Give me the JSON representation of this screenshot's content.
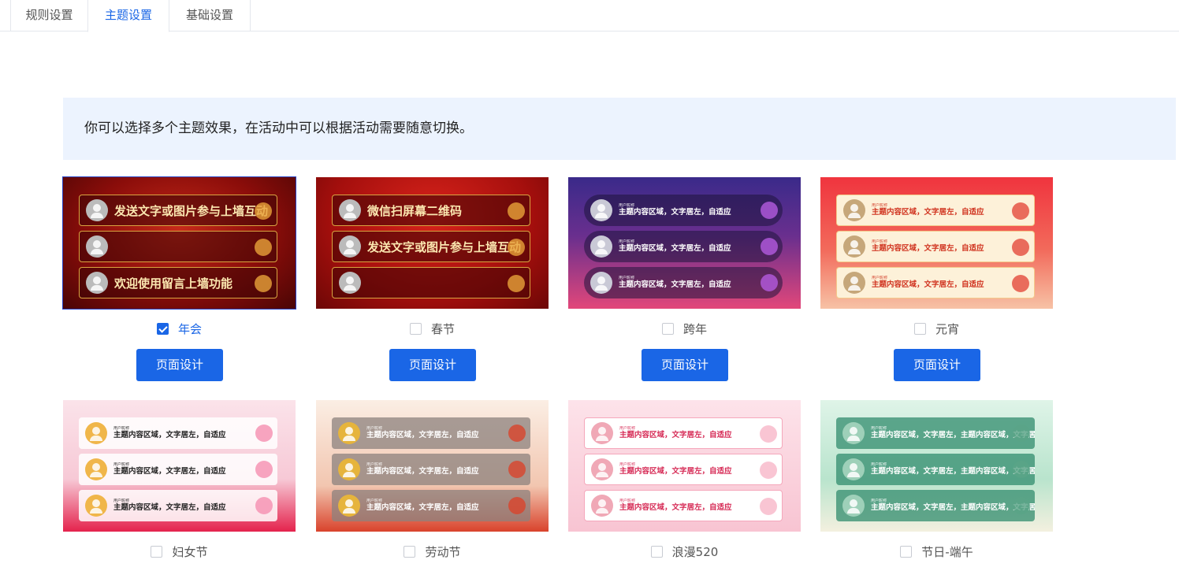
{
  "tabs": [
    "规则设置",
    "主题设置",
    "基础设置"
  ],
  "notice": "你可以选择多个主题效果，在活动中可以根据活动需要随意切换。",
  "design_button": "页面设计",
  "themes": [
    {
      "name": "年会",
      "checked": true,
      "nick": "用户昵称",
      "lines": [
        "发送文字或图片参与上墙互动",
        "",
        "欢迎使用留言上墙功能"
      ]
    },
    {
      "name": "春节",
      "checked": false,
      "nick": "用户昵称",
      "lines": [
        "微信扫屏幕二维码",
        "发送文字或图片参与上墙互动",
        ""
      ]
    },
    {
      "name": "跨年",
      "checked": false,
      "nick": "用户昵称",
      "lines": [
        "主题内容区域，文字居左，自适应",
        "主题内容区域，文字居左，自适应",
        "主题内容区域，文字居左，自适应"
      ]
    },
    {
      "name": "元宵",
      "checked": false,
      "nick": "用户昵称",
      "lines": [
        "主题内容区域，文字居左，自适应",
        "主题内容区域，文字居左，自适应",
        "主题内容区域，文字居左，自适应"
      ]
    },
    {
      "name": "妇女节",
      "checked": false,
      "nick": "用户昵称",
      "lines": [
        "主题内容区域，文字居左，自适应",
        "主题内容区域，文字居左，自适应",
        "主题内容区域，文字居左，自适应"
      ]
    },
    {
      "name": "劳动节",
      "checked": false,
      "nick": "用户昵称",
      "lines": [
        "主题内容区域，文字居左，自适应",
        "主题内容区域，文字居左，自适应",
        "主题内容区域，文字居左，自适应"
      ]
    },
    {
      "name": "浪漫520",
      "checked": false,
      "nick": "用户昵称",
      "lines": [
        "主题内容区域，文字居左，自适应",
        "主题内容区域，文字居左，自适应",
        "主题内容区域，文字居左，自适应"
      ]
    },
    {
      "name": "节日-端午",
      "checked": false,
      "nick": "用户昵称",
      "lines": [
        "主题内容区域，文字居左，主题内容区域，文字居左，自适应",
        "主题内容区域，文字居左，主题内容区域，文字居左，自适应",
        "主题内容区域，文字居左，主题内容区域，文字居左，自适应"
      ]
    }
  ]
}
